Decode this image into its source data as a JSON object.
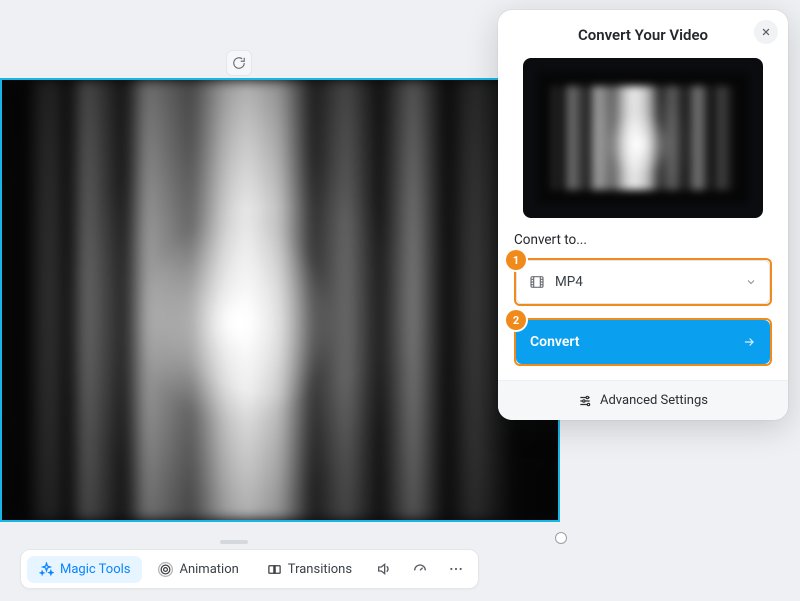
{
  "dialog": {
    "title": "Convert Your Video",
    "convert_to_label": "Convert to...",
    "format_selected": "MP4",
    "convert_button": "Convert",
    "advanced_settings": "Advanced Settings",
    "step1": "1",
    "step2": "2"
  },
  "toolbar": {
    "magic_tools": "Magic Tools",
    "animation": "Animation",
    "transitions": "Transitions"
  }
}
